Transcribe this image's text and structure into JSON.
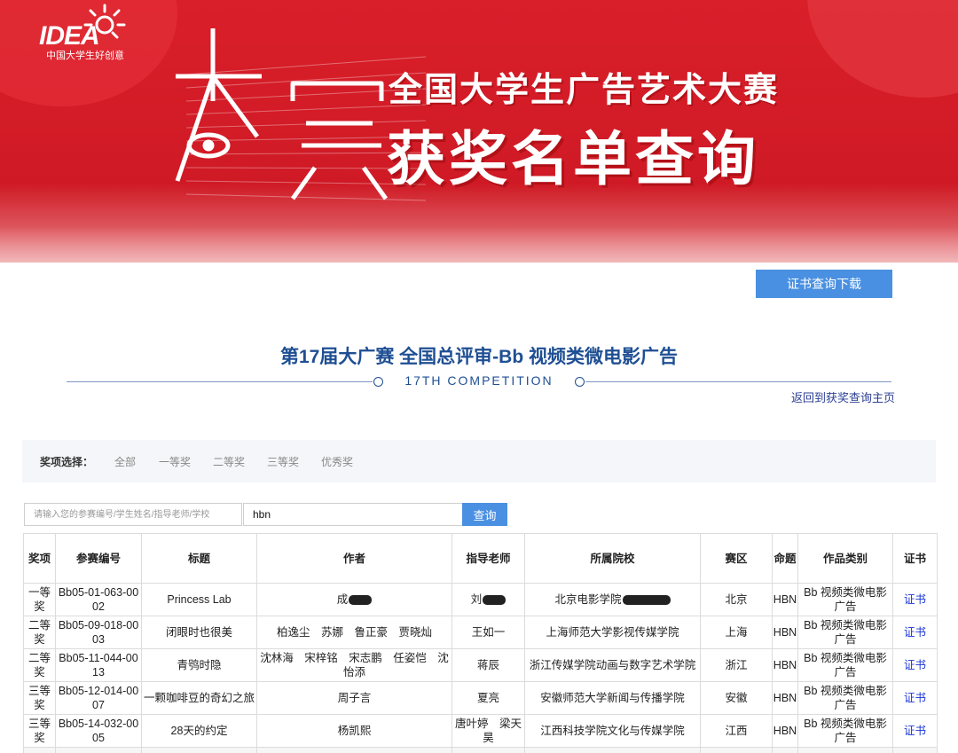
{
  "banner": {
    "logo_word": "IDEA",
    "logo_tagline": "中国大学生好创意",
    "headline_line1": "全国大学生广告艺术大赛",
    "headline_line2": "获奖名单查询",
    "colors": {
      "primary_red": "#d91f2a",
      "text": "#ffffff"
    }
  },
  "actions": {
    "certificate_download": "证书查询下载"
  },
  "competition": {
    "title": "第17届大广赛 全国总评审-Bb 视频类微电影广告",
    "subtitle": "17TH COMPETITION",
    "back_link": "返回到获奖查询主页"
  },
  "filter": {
    "label": "奖项选择：",
    "options": [
      "全部",
      "一等奖",
      "二等奖",
      "三等奖",
      "优秀奖"
    ]
  },
  "search": {
    "placeholder": "请输入您的参赛编号/学生姓名/指导老师/学校",
    "value": "hbn",
    "button": "查询"
  },
  "table": {
    "headers": [
      "奖项",
      "参赛编号",
      "标题",
      "作者",
      "指导老师",
      "所属院校",
      "赛区",
      "命题",
      "作品类别",
      "证书"
    ],
    "rows": [
      {
        "award": "一等奖",
        "id": "Bb05-01-063-0002",
        "title": "Princess Lab",
        "authors": "成",
        "advisor": "刘",
        "school": "北京电影学院",
        "region": "北京",
        "topic": "HBN",
        "category": "Bb 视频类微电影广告",
        "cert": "证书"
      },
      {
        "award": "二等奖",
        "id": "Bb05-09-018-0003",
        "title": "闭眼时也很美",
        "authors": "柏逸尘　苏娜　鲁正豪　贾晓灿",
        "advisor": "王如一",
        "school": "上海师范大学影视传媒学院",
        "region": "上海",
        "topic": "HBN",
        "category": "Bb 视频类微电影广告",
        "cert": "证书"
      },
      {
        "award": "二等奖",
        "id": "Bb05-11-044-0013",
        "title": "青鸮时隐",
        "authors": "沈林海　宋梓铭　宋志鹏　任姿恺　沈怡添",
        "advisor": "蒋辰",
        "school": "浙江传媒学院动画与数字艺术学院",
        "region": "浙江",
        "topic": "HBN",
        "category": "Bb 视频类微电影广告",
        "cert": "证书"
      },
      {
        "award": "三等奖",
        "id": "Bb05-12-014-0007",
        "title": "一颗咖啡豆的奇幻之旅",
        "authors": "周子言",
        "advisor": "夏亮",
        "school": "安徽师范大学新闻与传播学院",
        "region": "安徽",
        "topic": "HBN",
        "category": "Bb 视频类微电影广告",
        "cert": "证书"
      },
      {
        "award": "三等奖",
        "id": "Bb05-14-032-0005",
        "title": "28天的约定",
        "authors": "杨凯熙",
        "advisor": "唐叶婷　梁天昊",
        "school": "江西科技学院文化与传媒学院",
        "region": "江西",
        "topic": "HBN",
        "category": "Bb 视频类微电影广告",
        "cert": "证书"
      }
    ]
  }
}
